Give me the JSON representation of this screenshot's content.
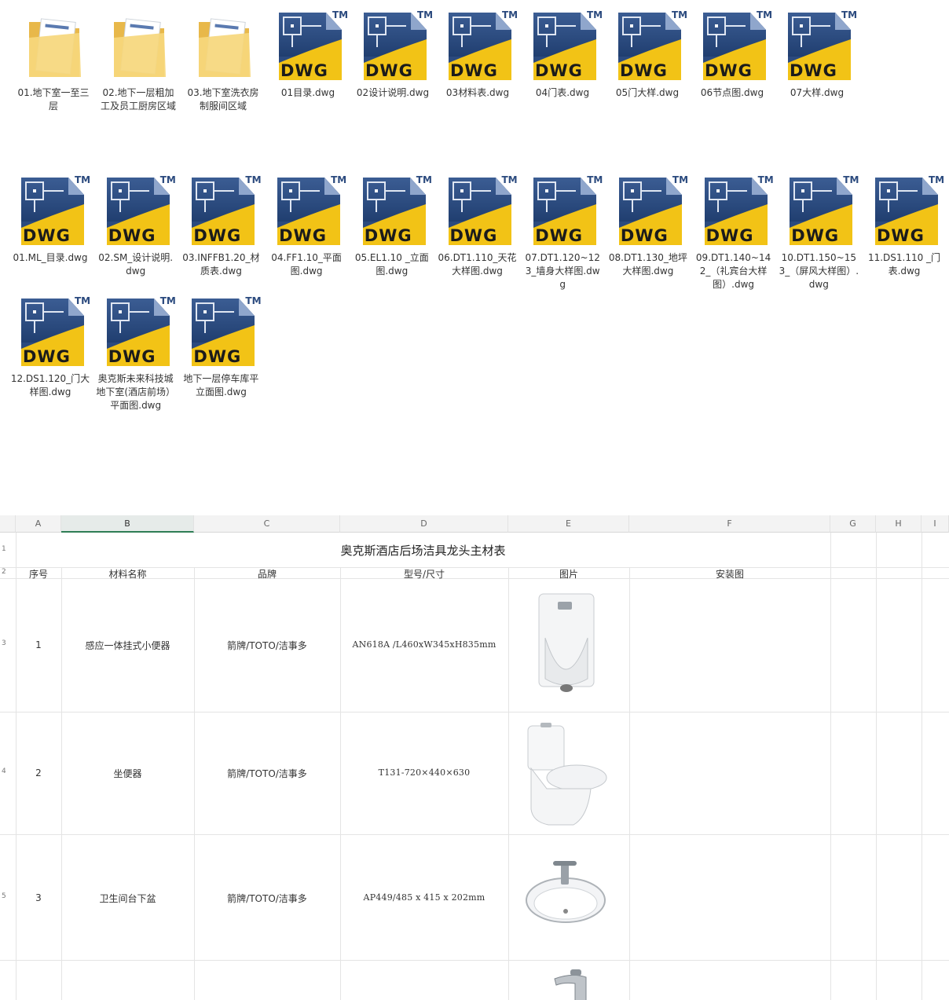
{
  "files": [
    {
      "type": "folder",
      "name": "01.地下室一至三层"
    },
    {
      "type": "folder",
      "name": "02.地下一层粗加工及员工厨房区域"
    },
    {
      "type": "folder",
      "name": "03.地下室洗衣房制服间区域"
    },
    {
      "type": "dwg",
      "name": "01目录.dwg"
    },
    {
      "type": "dwg",
      "name": "02设计说明.dwg"
    },
    {
      "type": "dwg",
      "name": "03材料表.dwg"
    },
    {
      "type": "dwg",
      "name": "04门表.dwg"
    },
    {
      "type": "dwg",
      "name": "05门大样.dwg"
    },
    {
      "type": "dwg",
      "name": "06节点图.dwg"
    },
    {
      "type": "dwg",
      "name": "07大样.dwg"
    },
    {
      "type": "dwg",
      "name": "01.ML_目录.dwg"
    },
    {
      "type": "dwg",
      "name": "02.SM_设计说明.dwg"
    },
    {
      "type": "dwg",
      "name": "03.INFFB1.20_材质表.dwg"
    },
    {
      "type": "dwg",
      "name": "04.FF1.10_平面图.dwg"
    },
    {
      "type": "dwg",
      "name": "05.EL1.10 _立面图.dwg"
    },
    {
      "type": "dwg",
      "name": "06.DT1.110_天花大样图.dwg"
    },
    {
      "type": "dwg",
      "name": "07.DT1.120~123_墙身大样图.dwg"
    },
    {
      "type": "dwg",
      "name": "08.DT1.130_地坪大样图.dwg"
    },
    {
      "type": "dwg",
      "name": "09.DT1.140~142_（礼宾台大样图）.dwg"
    },
    {
      "type": "dwg",
      "name": "10.DT1.150~153_（屏风大样图）.dwg"
    },
    {
      "type": "dwg",
      "name": "11.DS1.110 _门表.dwg"
    },
    {
      "type": "dwg",
      "name": "12.DS1.120_门大样图.dwg"
    },
    {
      "type": "dwg",
      "name": "奥克斯未来科技城地下室(酒店前场）平面图.dwg"
    },
    {
      "type": "dwg",
      "name": "地下一层停车库平立面图.dwg"
    }
  ],
  "icon": {
    "dwg_label": "DWG",
    "tm": "TM"
  },
  "sheet": {
    "columns": [
      "A",
      "B",
      "C",
      "D",
      "E",
      "F",
      "G",
      "H",
      "I"
    ],
    "row_numbers": [
      "1",
      "2",
      "3",
      "4",
      "5"
    ],
    "title": "奥克斯酒店后场洁具龙头主材表",
    "headers": {
      "seq": "序号",
      "name": "材料名称",
      "brand": "品牌",
      "model": "型号/尺寸",
      "image": "图片",
      "install": "安装图"
    },
    "rows": [
      {
        "seq": "1",
        "name": "感应一体挂式小便器",
        "brand": "箭牌/TOTO/洁事多",
        "model": "AN618A /L460xW345xH835mm",
        "image": "urinal-image"
      },
      {
        "seq": "2",
        "name": "坐便器",
        "brand": "箭牌/TOTO/洁事多",
        "model": "T131-720×440×630",
        "image": "toilet-image"
      },
      {
        "seq": "3",
        "name": "卫生间台下盆",
        "brand": "箭牌/TOTO/洁事多",
        "model": "AP449/485 x 415 x 202mm",
        "image": "basin-image"
      }
    ],
    "colors": {
      "active_col": "#2f7d55",
      "grid": "#e4e4e4",
      "header_bg": "#f3f3f3"
    }
  }
}
